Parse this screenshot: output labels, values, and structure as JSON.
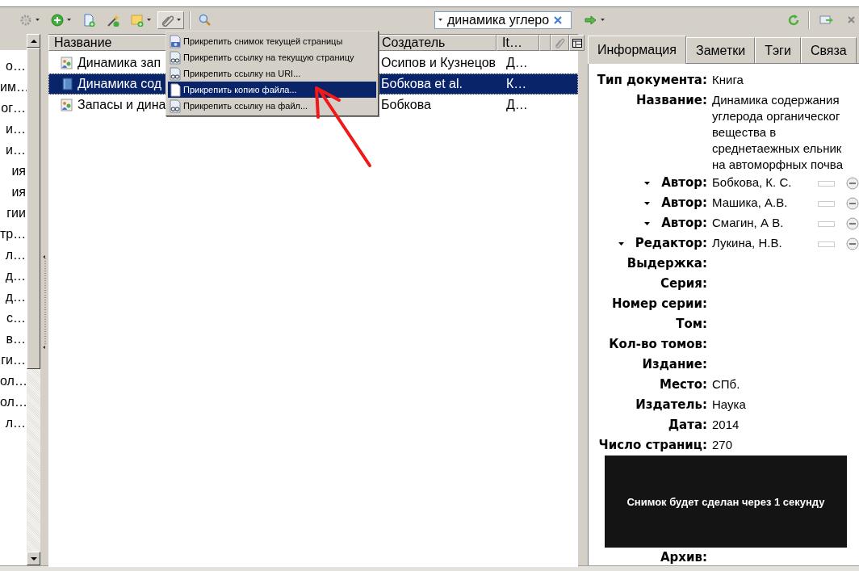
{
  "attachment_button": {
    "pressed": true
  },
  "search": {
    "value": "динамика углеро"
  },
  "collections": {
    "items": [
      "о…",
      "им…",
      "ог…",
      "и…",
      "и…",
      "ия",
      "ия",
      "гии",
      "тр…",
      "л…",
      "д…",
      "д…",
      "с…",
      "в…",
      "ги…",
      "ол…",
      "ол…",
      "л…"
    ]
  },
  "items_table": {
    "columns": [
      "Название",
      "Создатель",
      "It…"
    ],
    "rows": [
      {
        "title": "Динамика зап",
        "creator": "Осипов и Кузнецов",
        "item_type": "Д…",
        "selected": false
      },
      {
        "title": "Динамика сод",
        "creator": "Бобкова et al.",
        "item_type": "К…",
        "selected": true
      },
      {
        "title": "Запасы и дина",
        "creator": "Бобкова",
        "item_type": "Д…",
        "selected": false
      }
    ]
  },
  "attach_menu": {
    "items": [
      {
        "label": "Прикрепить снимок текущей страницы",
        "kind": "snapshot",
        "selected": false
      },
      {
        "label": "Прикрепить ссылку на текущую страницу",
        "kind": "link",
        "selected": false
      },
      {
        "label": "Прикрепить ссылку на URI...",
        "kind": "link",
        "selected": false
      },
      {
        "label": "Прикрепить копию файла...",
        "kind": "file",
        "selected": true
      },
      {
        "label": "Прикрепить ссылку на файл...",
        "kind": "link",
        "selected": false
      }
    ]
  },
  "info_tabs": [
    {
      "label": "Информация",
      "selected": true
    },
    {
      "label": "Заметки",
      "selected": false
    },
    {
      "label": "Тэги",
      "selected": false
    },
    {
      "label": "Связа",
      "selected": false
    }
  ],
  "info": {
    "fields": [
      {
        "kind": "field",
        "label": "Тип документа:",
        "value": "Книга"
      },
      {
        "kind": "multiline",
        "label": "Название:",
        "lines": [
          "Динамика содержания",
          "углерода органическог",
          "вещества в",
          "среднетаежных ельник",
          "на автоморфных почва"
        ]
      },
      {
        "kind": "creator",
        "label": "Автор:",
        "value": "Бобкова, К. С."
      },
      {
        "kind": "creator",
        "label": "Автор:",
        "value": "Машика, А.В."
      },
      {
        "kind": "creator",
        "label": "Автор:",
        "value": "Смагин, А В."
      },
      {
        "kind": "creator",
        "label": "Редактор:",
        "value": "Лукина, Н.В."
      },
      {
        "kind": "field",
        "label": "Выдержка:"
      },
      {
        "kind": "field",
        "label": "Серия:"
      },
      {
        "kind": "field",
        "label": "Номер серии:"
      },
      {
        "kind": "field",
        "label": "Том:"
      },
      {
        "kind": "field",
        "label": "Кол-во томов:"
      },
      {
        "kind": "field",
        "label": "Издание:"
      },
      {
        "kind": "field",
        "label": "Место:",
        "value": "СПб."
      },
      {
        "kind": "field",
        "label": "Издатель:",
        "value": "Наука"
      },
      {
        "kind": "field",
        "label": "Дата:",
        "value": "2014"
      },
      {
        "kind": "field",
        "label": "Число страниц:",
        "value": "270"
      }
    ],
    "snapshot_notice": "Снимок будет сделан через 1 секунду",
    "after_notice": [
      {
        "kind": "field",
        "label": "Архив:"
      }
    ]
  }
}
